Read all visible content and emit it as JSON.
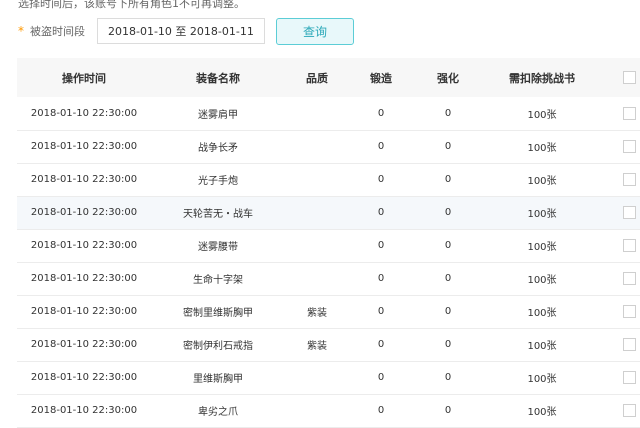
{
  "top_note": "选择时间后，该账号下所有角色1不可再调整。",
  "filter": {
    "required_mark": "*",
    "label": "被盗时间段",
    "date_range_value": "2018-01-10 至 2018-01-11",
    "query_label": "查询"
  },
  "table": {
    "columns": [
      "操作时间",
      "装备名称",
      "品质",
      "锻造",
      "强化",
      "需扣除挑战书"
    ],
    "rows": [
      {
        "time": "2018-01-10 22:30:00",
        "name": "迷雾肩甲",
        "quality": "",
        "forge": "0",
        "enhance": "0",
        "cost": "100张"
      },
      {
        "time": "2018-01-10 22:30:00",
        "name": "战争长矛",
        "quality": "",
        "forge": "0",
        "enhance": "0",
        "cost": "100张"
      },
      {
        "time": "2018-01-10 22:30:00",
        "name": "光子手炮",
        "quality": "",
        "forge": "0",
        "enhance": "0",
        "cost": "100张"
      },
      {
        "time": "2018-01-10 22:30:00",
        "name": "天轮苦无・战车",
        "quality": "",
        "forge": "0",
        "enhance": "0",
        "cost": "100张"
      },
      {
        "time": "2018-01-10 22:30:00",
        "name": "迷雾腰带",
        "quality": "",
        "forge": "0",
        "enhance": "0",
        "cost": "100张"
      },
      {
        "time": "2018-01-10 22:30:00",
        "name": "生命十字架",
        "quality": "",
        "forge": "0",
        "enhance": "0",
        "cost": "100张"
      },
      {
        "time": "2018-01-10 22:30:00",
        "name": "密制里维斯胸甲",
        "quality": "紫装",
        "forge": "0",
        "enhance": "0",
        "cost": "100张"
      },
      {
        "time": "2018-01-10 22:30:00",
        "name": "密制伊利石戒指",
        "quality": "紫装",
        "forge": "0",
        "enhance": "0",
        "cost": "100张"
      },
      {
        "time": "2018-01-10 22:30:00",
        "name": "里维斯胸甲",
        "quality": "",
        "forge": "0",
        "enhance": "0",
        "cost": "100张"
      },
      {
        "time": "2018-01-10 22:30:00",
        "name": "卑劣之爪",
        "quality": "",
        "forge": "0",
        "enhance": "0",
        "cost": "100张"
      }
    ]
  }
}
